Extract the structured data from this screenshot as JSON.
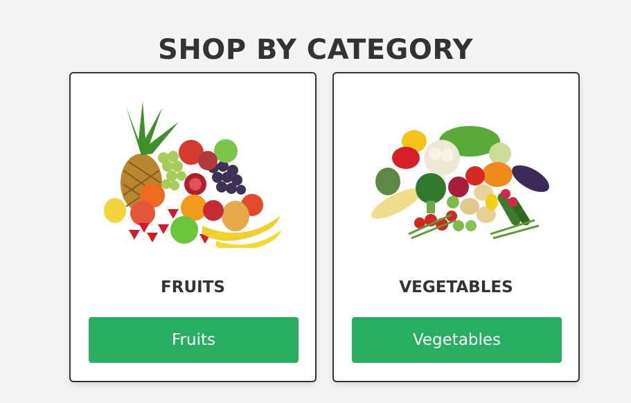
{
  "page": {
    "heading": "SHOP BY CATEGORY"
  },
  "categories": [
    {
      "name": "FRUITS",
      "button_label": "Fruits",
      "image": "fruits-image"
    },
    {
      "name": "VEGETABLES",
      "button_label": "Vegetables",
      "image": "vegetables-image"
    }
  ],
  "colors": {
    "button": "#27ae60",
    "heading": "#333333",
    "card_border": "#333333",
    "background": "#f4f4f4"
  }
}
